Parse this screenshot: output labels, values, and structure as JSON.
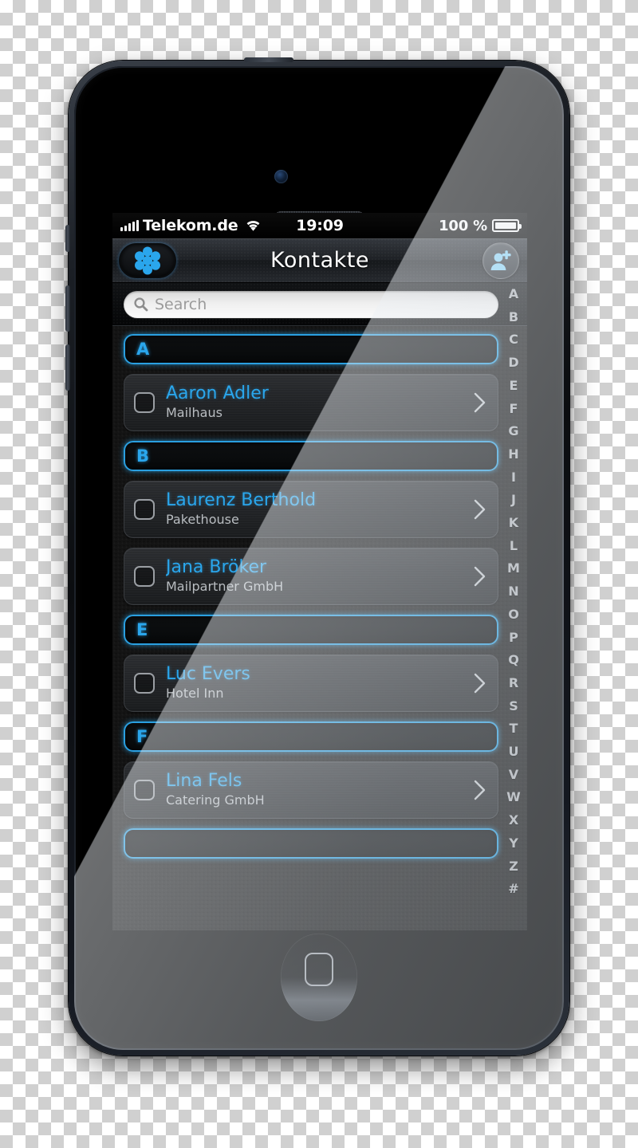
{
  "device": {
    "name": "iphone-5-black",
    "frame_color": "#1b1f25",
    "accent_color": "#2aa6ec"
  },
  "status_bar": {
    "signal_icon": "signal-bars-icon",
    "carrier": "Telekom.de",
    "wifi_icon": "wifi-icon",
    "time": "19:09",
    "battery_percent": "100 %",
    "battery_icon": "battery-full-icon"
  },
  "nav_bar": {
    "logo_icon": "app-logo-icon",
    "title": "Kontakte",
    "add_contact_icon": "add-person-icon"
  },
  "search": {
    "icon": "search-icon",
    "placeholder": "Search",
    "value": ""
  },
  "list": {
    "chevron_icon": "chevron-right-icon",
    "checkbox_icon": "checkbox-unchecked-icon",
    "sections": [
      {
        "letter": "A",
        "contacts": [
          {
            "name": "Aaron Adler",
            "company": "Mailhaus"
          }
        ]
      },
      {
        "letter": "B",
        "contacts": [
          {
            "name": "Laurenz Berthold",
            "company": "Pakethouse"
          },
          {
            "name": "Jana Bröker",
            "company": "Mailpartner GmbH"
          }
        ]
      },
      {
        "letter": "E",
        "contacts": [
          {
            "name": "Luc Evers",
            "company": "Hotel Inn"
          }
        ]
      },
      {
        "letter": "F",
        "contacts": [
          {
            "name": "Lina Fels",
            "company": "Catering GmbH"
          }
        ]
      },
      {
        "letter": "",
        "contacts": []
      }
    ]
  },
  "index_bar": {
    "letters": [
      "A",
      "B",
      "C",
      "D",
      "E",
      "F",
      "G",
      "H",
      "I",
      "J",
      "K",
      "L",
      "M",
      "N",
      "O",
      "P",
      "Q",
      "R",
      "S",
      "T",
      "U",
      "V",
      "W",
      "X",
      "Y",
      "Z",
      "#"
    ]
  }
}
